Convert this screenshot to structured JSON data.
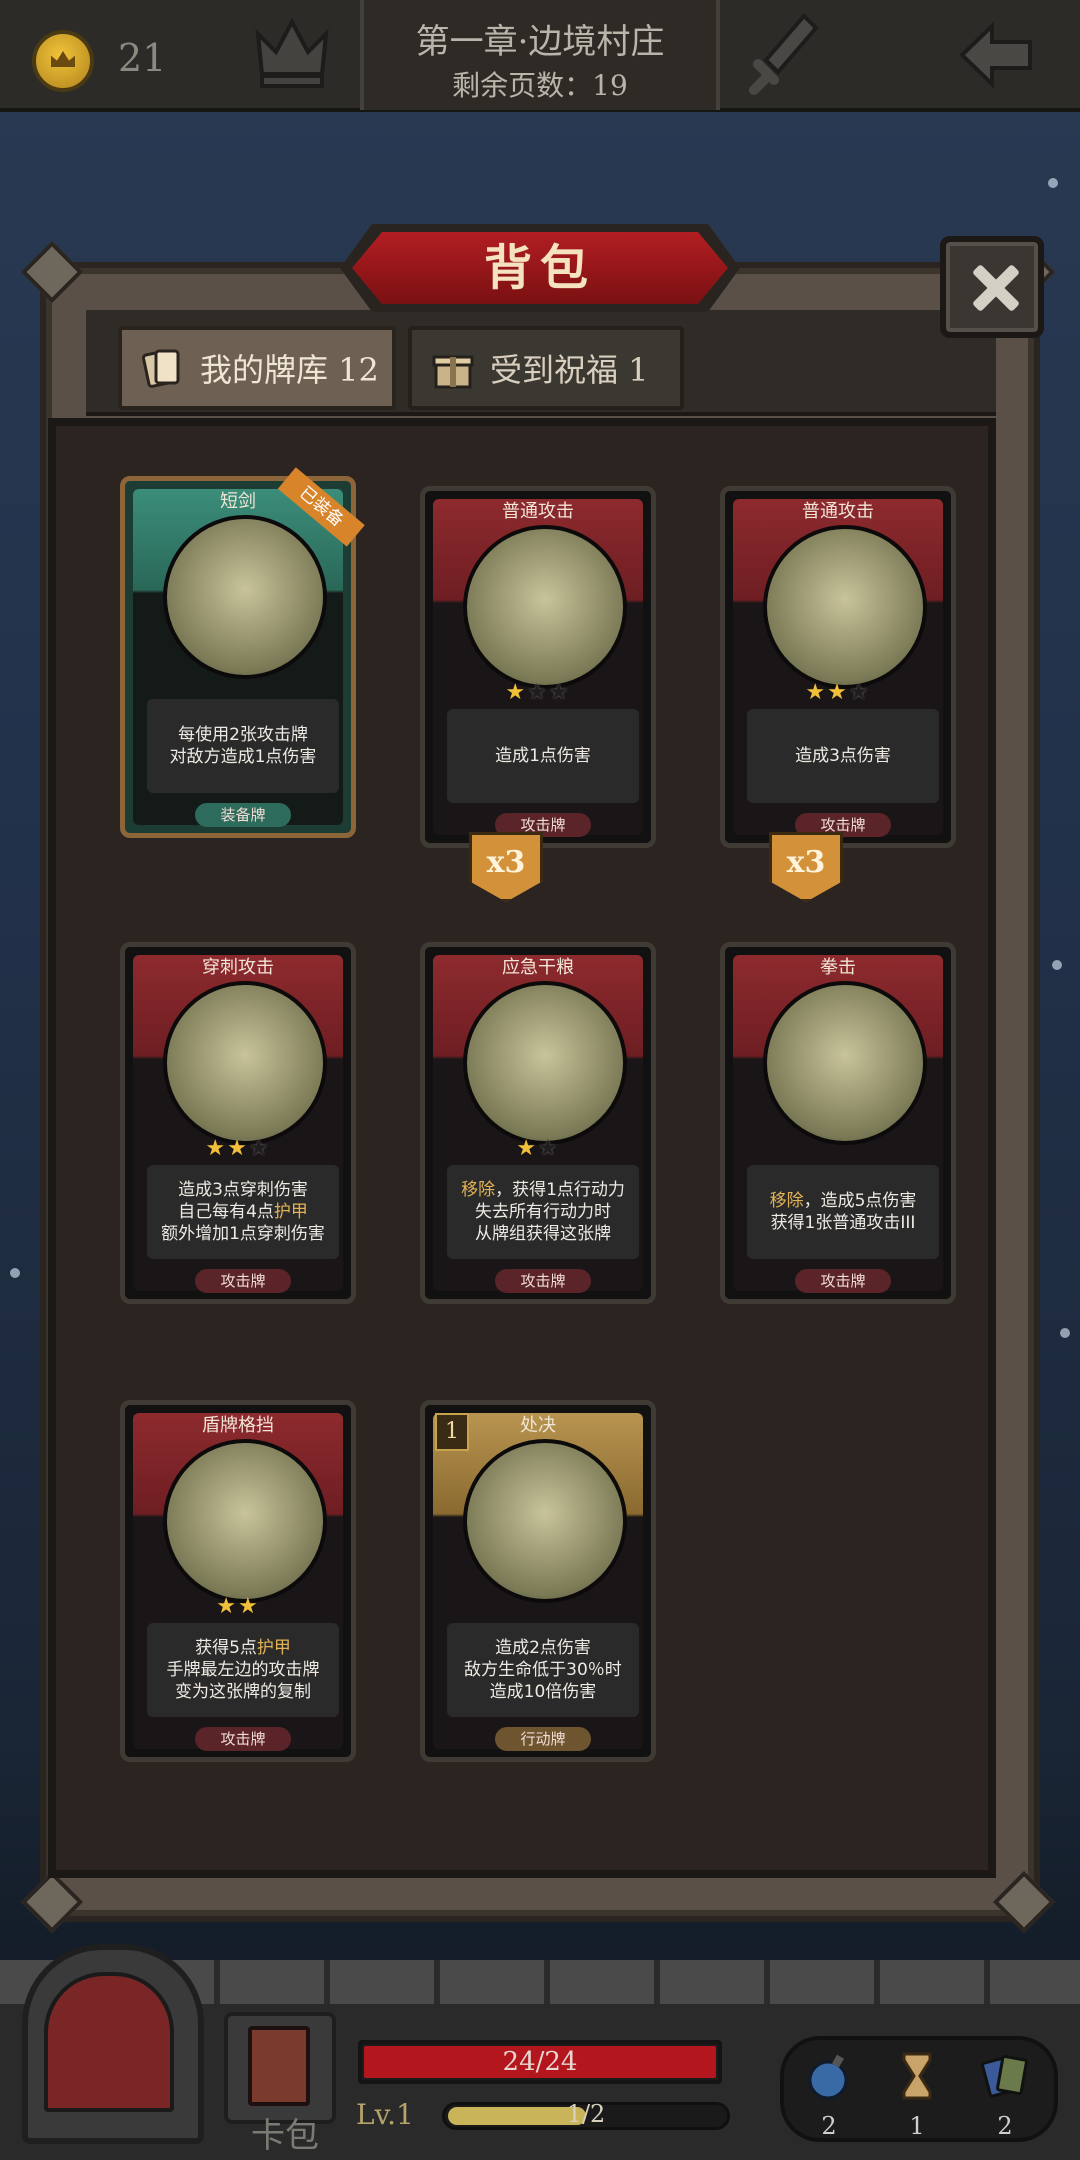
{
  "top": {
    "coins": "21",
    "chapter_title": "第一章·边境村庄",
    "pages_left": "剩余页数：19"
  },
  "panel": {
    "title": "背包",
    "tabs": [
      {
        "label": "我的牌库 12",
        "selected": true
      },
      {
        "label": "受到祝福 1",
        "selected": false
      }
    ]
  },
  "cards": [
    {
      "name": "短剑",
      "badge": "已装备",
      "desc_lines": [
        "每使用2张攻击牌",
        "对敌方造成1点伤害"
      ],
      "type": "装备牌",
      "stars": 0,
      "max_stars": 0,
      "count": "",
      "cost": "",
      "frame": "green"
    },
    {
      "name": "普通攻击",
      "badge": "",
      "desc_lines": [
        "造成1点伤害"
      ],
      "type": "攻击牌",
      "stars": 1,
      "max_stars": 3,
      "count": "x3",
      "cost": "",
      "frame": "red"
    },
    {
      "name": "普通攻击",
      "badge": "",
      "desc_lines": [
        "造成3点伤害"
      ],
      "type": "攻击牌",
      "stars": 2,
      "max_stars": 3,
      "count": "x3",
      "cost": "",
      "frame": "red"
    },
    {
      "name": "穿刺攻击",
      "badge": "",
      "desc_lines": [
        "造成3点穿刺伤害",
        "自己每有4点护甲",
        "额外增加1点穿刺伤害"
      ],
      "type": "攻击牌",
      "stars": 2,
      "max_stars": 3,
      "count": "",
      "cost": "",
      "frame": "red"
    },
    {
      "name": "应急干粮",
      "badge": "",
      "desc_lines": [
        "移除，获得1点行动力",
        "失去所有行动力时",
        "从牌组获得这张牌"
      ],
      "type": "攻击牌",
      "stars": 1,
      "max_stars": 2,
      "count": "",
      "cost": "",
      "frame": "red"
    },
    {
      "name": "拳击",
      "badge": "",
      "desc_lines": [
        "移除，造成5点伤害",
        "获得1张普通攻击III"
      ],
      "type": "攻击牌",
      "stars": 0,
      "max_stars": 0,
      "count": "",
      "cost": "",
      "frame": "red"
    },
    {
      "name": "盾牌格挡",
      "badge": "",
      "desc_lines": [
        "获得5点护甲",
        "手牌最左边的攻击牌",
        "变为这张牌的复制"
      ],
      "type": "攻击牌",
      "stars": 2,
      "max_stars": 2,
      "count": "",
      "cost": "",
      "frame": "red"
    },
    {
      "name": "处决",
      "badge": "",
      "desc_lines": [
        "造成2点伤害",
        "敌方生命低于30％时",
        "造成10倍伤害"
      ],
      "type": "行动牌",
      "stars": 0,
      "max_stars": 0,
      "count": "",
      "cost": "1",
      "frame": "gold"
    }
  ],
  "bottom": {
    "pack_label": "卡包",
    "hp_text": "24/24",
    "hp_fraction": 1.0,
    "level": "Lv.1",
    "xp_text": "1/2",
    "xp_fraction": 0.5,
    "items": [
      {
        "icon": "bomb-icon",
        "count": "2"
      },
      {
        "icon": "hourglass-icon",
        "count": "1"
      },
      {
        "icon": "cards-icon",
        "count": "2"
      }
    ]
  },
  "colors": {
    "accent_red": "#b21e22",
    "highlight": "#e2b356",
    "coin_gold": "#f0c43a"
  }
}
